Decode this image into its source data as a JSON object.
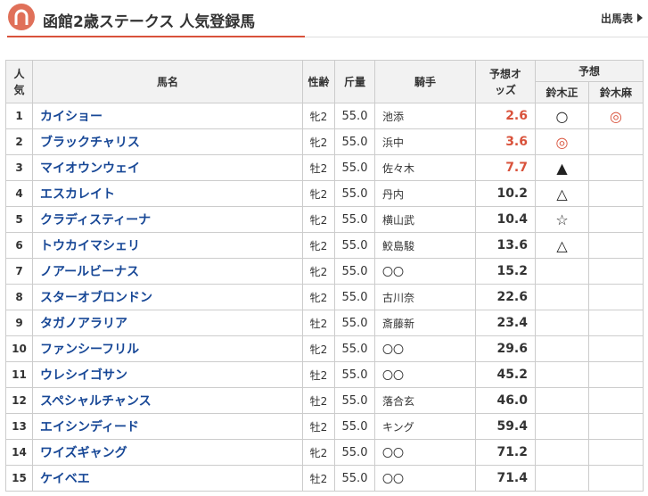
{
  "header": {
    "title": "函館2歳ステークス 人気登録馬",
    "shutuba_link": "出馬表"
  },
  "table": {
    "col_rank": "人気",
    "col_name": "馬名",
    "col_sexage": "性齢",
    "col_weight": "斤量",
    "col_jockey": "騎手",
    "col_odds": "予想オッズ",
    "col_pred": "予想",
    "predictor_1": "鈴木正",
    "predictor_2": "鈴木麻",
    "rows": [
      {
        "rank": "1",
        "name": "カイショー",
        "sexage": "牝2",
        "weight": "55.0",
        "jockey": "池添",
        "odds": "2.6",
        "hot": true,
        "mark1": "○",
        "mark1_color": "#222",
        "mark2": "◎",
        "mark2_color": "#d9523b"
      },
      {
        "rank": "2",
        "name": "ブラックチャリス",
        "sexage": "牝2",
        "weight": "55.0",
        "jockey": "浜中",
        "odds": "3.6",
        "hot": true,
        "mark1": "◎",
        "mark1_color": "#d9523b",
        "mark2": "",
        "mark2_color": "#222"
      },
      {
        "rank": "3",
        "name": "マイオウンウェイ",
        "sexage": "牡2",
        "weight": "55.0",
        "jockey": "佐々木",
        "odds": "7.7",
        "hot": true,
        "mark1": "▲",
        "mark1_color": "#222",
        "mark2": "",
        "mark2_color": "#222"
      },
      {
        "rank": "4",
        "name": "エスカレイト",
        "sexage": "牝2",
        "weight": "55.0",
        "jockey": "丹内",
        "odds": "10.2",
        "hot": false,
        "mark1": "△",
        "mark1_color": "#222",
        "mark2": "",
        "mark2_color": "#222"
      },
      {
        "rank": "5",
        "name": "クラディスティーナ",
        "sexage": "牝2",
        "weight": "55.0",
        "jockey": "横山武",
        "odds": "10.4",
        "hot": false,
        "mark1": "☆",
        "mark1_color": "#222",
        "mark2": "",
        "mark2_color": "#222"
      },
      {
        "rank": "6",
        "name": "トウカイマシェリ",
        "sexage": "牝2",
        "weight": "55.0",
        "jockey": "鮫島駿",
        "odds": "13.6",
        "hot": false,
        "mark1": "△",
        "mark1_color": "#222",
        "mark2": "",
        "mark2_color": "#222"
      },
      {
        "rank": "7",
        "name": "ノアールビーナス",
        "sexage": "牝2",
        "weight": "55.0",
        "jockey": "〇〇",
        "odds": "15.2",
        "hot": false,
        "mark1": "",
        "mark1_color": "#222",
        "mark2": "",
        "mark2_color": "#222"
      },
      {
        "rank": "8",
        "name": "スターオブロンドン",
        "sexage": "牝2",
        "weight": "55.0",
        "jockey": "古川奈",
        "odds": "22.6",
        "hot": false,
        "mark1": "",
        "mark1_color": "#222",
        "mark2": "",
        "mark2_color": "#222"
      },
      {
        "rank": "9",
        "name": "タガノアラリア",
        "sexage": "牡2",
        "weight": "55.0",
        "jockey": "斎藤新",
        "odds": "23.4",
        "hot": false,
        "mark1": "",
        "mark1_color": "#222",
        "mark2": "",
        "mark2_color": "#222"
      },
      {
        "rank": "10",
        "name": "ファンシーフリル",
        "sexage": "牝2",
        "weight": "55.0",
        "jockey": "〇〇",
        "odds": "29.6",
        "hot": false,
        "mark1": "",
        "mark1_color": "#222",
        "mark2": "",
        "mark2_color": "#222"
      },
      {
        "rank": "11",
        "name": "ウレシイゴサン",
        "sexage": "牡2",
        "weight": "55.0",
        "jockey": "〇〇",
        "odds": "45.2",
        "hot": false,
        "mark1": "",
        "mark1_color": "#222",
        "mark2": "",
        "mark2_color": "#222"
      },
      {
        "rank": "12",
        "name": "スペシャルチャンス",
        "sexage": "牡2",
        "weight": "55.0",
        "jockey": "落合玄",
        "odds": "46.0",
        "hot": false,
        "mark1": "",
        "mark1_color": "#222",
        "mark2": "",
        "mark2_color": "#222"
      },
      {
        "rank": "13",
        "name": "エイシンディード",
        "sexage": "牡2",
        "weight": "55.0",
        "jockey": "キング",
        "odds": "59.4",
        "hot": false,
        "mark1": "",
        "mark1_color": "#222",
        "mark2": "",
        "mark2_color": "#222"
      },
      {
        "rank": "14",
        "name": "ワイズギャング",
        "sexage": "牝2",
        "weight": "55.0",
        "jockey": "〇〇",
        "odds": "71.2",
        "hot": false,
        "mark1": "",
        "mark1_color": "#222",
        "mark2": "",
        "mark2_color": "#222"
      },
      {
        "rank": "15",
        "name": "ケイベエ",
        "sexage": "牡2",
        "weight": "55.0",
        "jockey": "〇〇",
        "odds": "71.4",
        "hot": false,
        "mark1": "",
        "mark1_color": "#222",
        "mark2": "",
        "mark2_color": "#222"
      }
    ]
  },
  "colors": {
    "accent": "#d9523b",
    "link": "#174796",
    "header_bg": "#f2f2f2"
  }
}
